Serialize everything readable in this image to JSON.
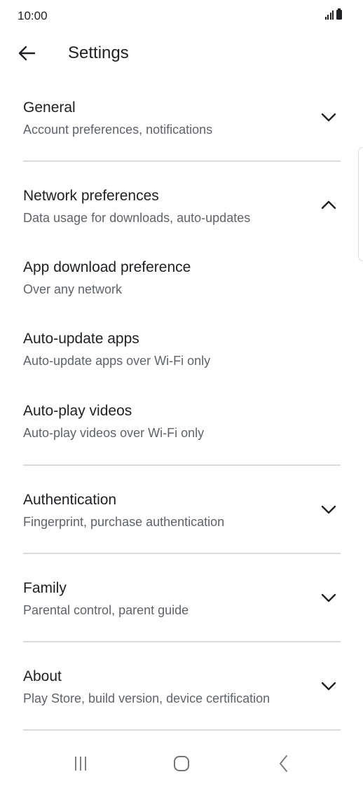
{
  "status_bar": {
    "time": "10:00"
  },
  "app_bar": {
    "title": "Settings"
  },
  "sections": [
    {
      "title": "General",
      "subtitle": "Account preferences, notifications",
      "expanded": false
    },
    {
      "title": "Network preferences",
      "subtitle": "Data usage for downloads, auto-updates",
      "expanded": true,
      "items": [
        {
          "title": "App download preference",
          "subtitle": "Over any network"
        },
        {
          "title": "Auto-update apps",
          "subtitle": "Auto-update apps over Wi-Fi only"
        },
        {
          "title": "Auto-play videos",
          "subtitle": "Auto-play videos over Wi-Fi only"
        }
      ]
    },
    {
      "title": "Authentication",
      "subtitle": "Fingerprint, purchase authentication",
      "expanded": false
    },
    {
      "title": "Family",
      "subtitle": "Parental control, parent guide",
      "expanded": false
    },
    {
      "title": "About",
      "subtitle": "Play Store, build version, device certification",
      "expanded": false
    }
  ],
  "icons": {
    "back": "arrow-back-icon",
    "expand": "chevron-down-icon",
    "collapse": "chevron-up-icon",
    "recents": "recents-icon",
    "home": "home-icon",
    "nav_back": "nav-back-icon"
  },
  "colors": {
    "text_primary": "#202124",
    "text_secondary": "#5f6368",
    "divider": "#dadce0",
    "nav_icon": "#757575"
  }
}
